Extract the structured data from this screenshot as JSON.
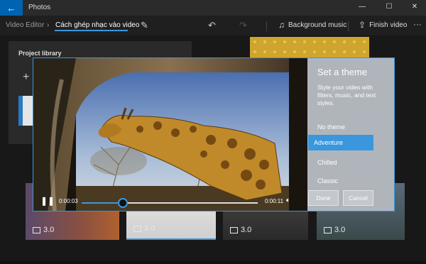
{
  "titlebar": {
    "app_title": "Photos",
    "back_icon": "back-arrow-icon",
    "minimize": "—",
    "maximize": "☐",
    "close": "✕"
  },
  "toolbar": {
    "breadcrumb_parent": "Video Editor",
    "breadcrumb_sep": "›",
    "breadcrumb_current": "Cách ghép nhạc vào video",
    "background_music_label": "Background music",
    "finish_video_label": "Finish video",
    "more_label": "···"
  },
  "project_library": {
    "title": "Project library",
    "add_label": "+"
  },
  "video": {
    "current_time": "0:00:03",
    "end_time": "0:00:11",
    "progress": 0.235
  },
  "theme_panel": {
    "title": "Set a theme",
    "description": "Style your video with filters, music, and text styles.",
    "items": [
      {
        "label": "No theme",
        "selected": false
      },
      {
        "label": "Adventure",
        "selected": true
      },
      {
        "label": "Chilled",
        "selected": false
      },
      {
        "label": "Classic",
        "selected": false
      }
    ],
    "done_label": "Done",
    "cancel_label": "Cancel"
  },
  "storyboard": {
    "tiles": [
      {
        "duration": "3.0"
      },
      {
        "duration": "3.0"
      },
      {
        "duration": "3.0"
      },
      {
        "duration": "3.0"
      }
    ]
  },
  "colors": {
    "accent": "#3a96dd",
    "titlebar_accent": "#0063b1",
    "background": "#1a1a1a"
  }
}
